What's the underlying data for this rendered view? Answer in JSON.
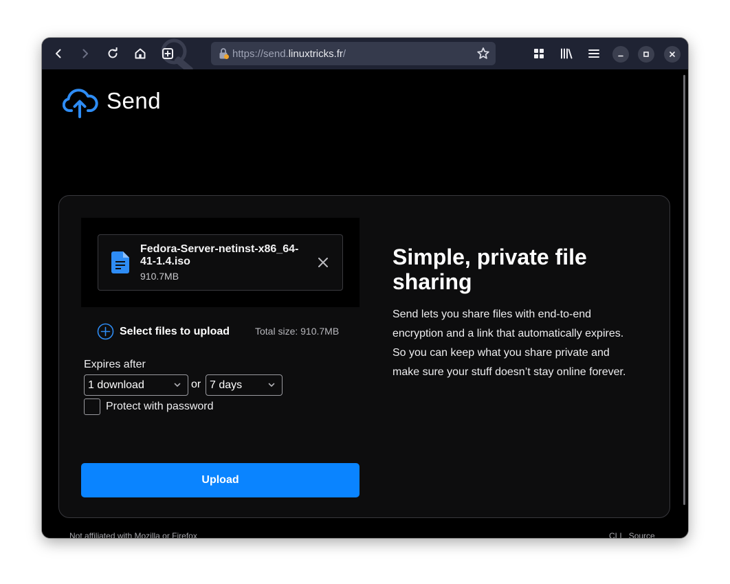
{
  "browser": {
    "url_prefix": "https://send.",
    "url_domain": "linuxtricks.fr",
    "url_suffix": "/",
    "icons": [
      "back-icon",
      "forward-icon",
      "reload-icon",
      "home-icon",
      "new-tab-icon",
      "lock-icon",
      "bookmark-star-icon",
      "extensions-grid-icon",
      "library-icon",
      "menu-icon",
      "minimize-icon",
      "maximize-icon",
      "close-icon"
    ]
  },
  "app": {
    "logo_text": "Send",
    "accent": "#0a84ff"
  },
  "upload_panel": {
    "file": {
      "name": "Fedora-Server-netinst-x86_64-41-1.4.iso",
      "size": "910.7MB"
    },
    "select_files_label": "Select files to upload",
    "total_size": "Total size: 910.7MB",
    "expires_label": "Expires after",
    "downloads_value": "1 download",
    "or_label": "or",
    "days_value": "7 days",
    "password_label": "Protect with password",
    "upload_button": "Upload"
  },
  "intro": {
    "title": "Simple, private file sharing",
    "body": "Send lets you share files with end-to-end encryption and a link that automatically expires. So you can keep what you share private and make sure your stuff doesn’t stay online forever."
  },
  "footer": {
    "disclaimer": "Not affiliated with Mozilla or Firefox",
    "links": [
      "CLI",
      "Source"
    ]
  }
}
